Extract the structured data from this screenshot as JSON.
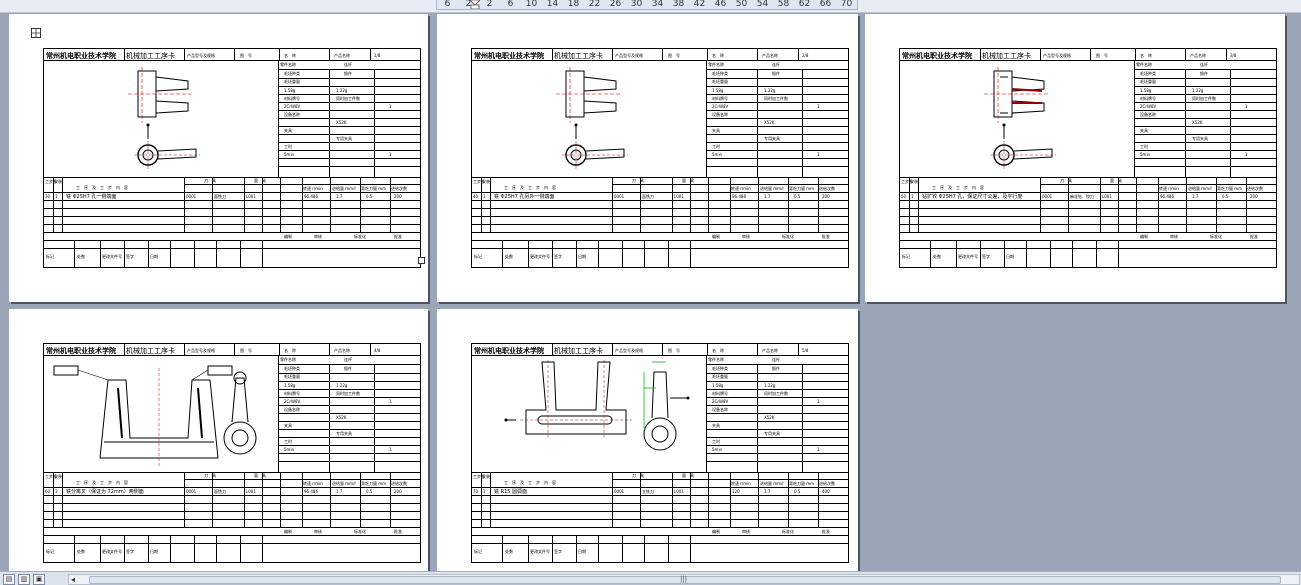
{
  "ruler": {
    "ticks": [
      "6",
      "2",
      "2",
      "6",
      "10",
      "14",
      "18",
      "22",
      "26",
      "30",
      "34",
      "38",
      "42",
      "46",
      "50",
      "54",
      "58",
      "62",
      "66",
      "70"
    ]
  },
  "common": {
    "school": "常州机电职业技术学院",
    "card_title": "机械加工工序卡",
    "product_code_label": "产品型号及规格",
    "drawing_no_label": "图　号",
    "name_label": "名　称",
    "product_name_label": "产品名称",
    "page_label": "第 页",
    "part_name_label": "零件名称",
    "part_name_value": "连杆",
    "material_label": "材料牌号",
    "material_value": "2CrW8V",
    "blank_label": "毛坯种类",
    "forging": "锻件",
    "weight_label": "毛坯重量",
    "weight_value": "1.58g",
    "weight2_value": "1.22g",
    "count_label": "同时加工件数",
    "count_value": "1",
    "equipment_label": "设备名称",
    "equipment_value": "X52K",
    "fixture_label": "夹具",
    "fixture_value": "专用夹具",
    "time_label": "工时",
    "time_value": "5min",
    "col_step_no": "工步号",
    "col_install": "安装",
    "col_content": "工　序　及　工　步　内　容",
    "col_tool": "刀　具",
    "col_gauge": "量　具",
    "col_speed": "转速 r/min",
    "col_feed": "进给量 mm/r",
    "col_depth": "背吃刀量 mm",
    "col_passes": "进给次数",
    "col_hours": "工时定额",
    "footer_designer": "编制",
    "footer_checker": "审核",
    "footer_std": "标准化",
    "footer_approve": "批准",
    "footer_mark": "标记",
    "footer_count": "处数",
    "footer_file": "更改文件号",
    "footer_sign": "签字",
    "footer_date": "日期",
    "tool_code": "0001",
    "tool_name": "面铣刀",
    "gauge_code": "L001",
    "rpm": "96.486",
    "feed": "1.7",
    "depth": "0.5",
    "passes": "200"
  },
  "pages": [
    {
      "page_no": "1/8",
      "op_no": "30",
      "step": "1",
      "content": "铣 Φ25H7 孔一侧端面"
    },
    {
      "page_no": "2/8",
      "op_no": "40",
      "step": "1",
      "content": "铣 Φ25H7 孔另外一侧端面"
    },
    {
      "page_no": "3/8",
      "op_no": "50",
      "step": "1",
      "content": "钻扩铰 Φ25H7 孔，保证尺寸公差，及平行度",
      "tool_name": "麻花钻、铰刀"
    },
    {
      "page_no": "4/8",
      "op_no": "60",
      "step": "1",
      "content": "铣分离叉（保证为 72mm）两侧面"
    },
    {
      "page_no": "5/8",
      "op_no": "70",
      "step": "1",
      "content": "铣 R15 圆弧面",
      "tool_name": "立铣刀",
      "rpm": "120",
      "passes": "400"
    }
  ],
  "status_bar": {
    "view_normal": "▤",
    "view_web": "▥",
    "view_print": "▣",
    "scroll_grip": "|||"
  }
}
